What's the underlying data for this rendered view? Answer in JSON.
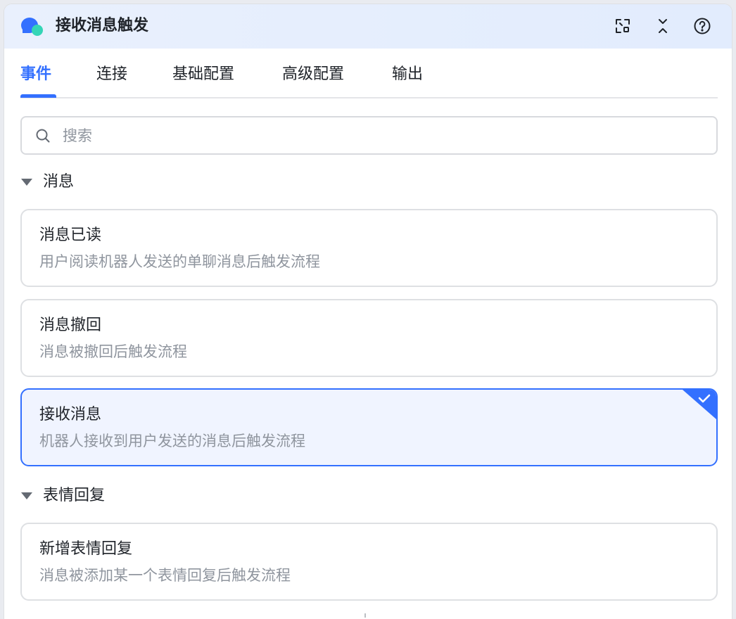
{
  "header": {
    "title": "接收消息触发",
    "logo_icon": "chat-bubble-icon",
    "actions": [
      {
        "name": "fullscreen-icon"
      },
      {
        "name": "collapse-icon"
      },
      {
        "name": "help-icon"
      }
    ],
    "accent_color": "#3370ff"
  },
  "tabs": [
    {
      "label": "事件",
      "active": true
    },
    {
      "label": "连接",
      "active": false
    },
    {
      "label": "基础配置",
      "active": false
    },
    {
      "label": "高级配置",
      "active": false
    },
    {
      "label": "输出",
      "active": false
    }
  ],
  "search": {
    "placeholder": "搜索",
    "value": ""
  },
  "groups": [
    {
      "label": "消息",
      "expanded": true,
      "items": [
        {
          "title": "消息已读",
          "description": "用户阅读机器人发送的单聊消息后触发流程",
          "selected": false
        },
        {
          "title": "消息撤回",
          "description": "消息被撤回后触发流程",
          "selected": false
        },
        {
          "title": "接收消息",
          "description": "机器人接收到用户发送的消息后触发流程",
          "selected": true
        }
      ]
    },
    {
      "label": "表情回复",
      "expanded": true,
      "items": [
        {
          "title": "新增表情回复",
          "description": "消息被添加某一个表情回复后触发流程",
          "selected": false
        }
      ]
    }
  ]
}
